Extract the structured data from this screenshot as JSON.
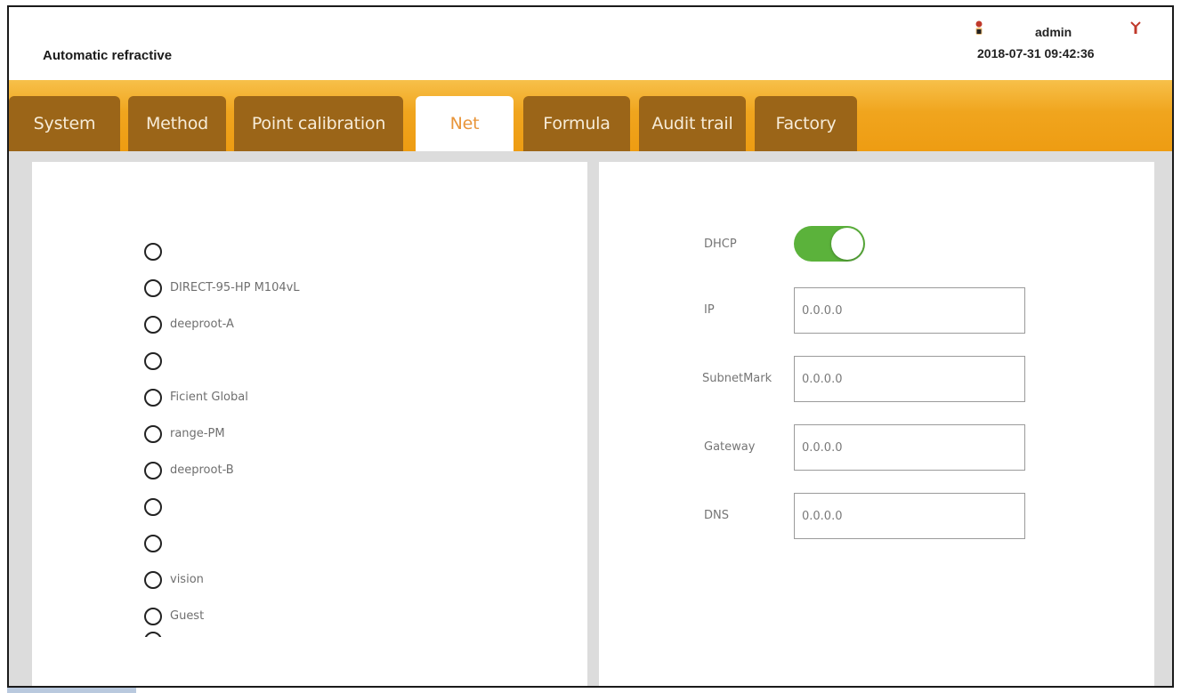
{
  "header": {
    "app_title": "Automatic refractive",
    "user_name": "admin",
    "datetime": "2018-07-31 09:42:36",
    "user_icon": "user-icon",
    "logout_icon": "logout-icon"
  },
  "tabs": [
    {
      "label": "System",
      "active": false
    },
    {
      "label": "Method",
      "active": false
    },
    {
      "label": "Point calibration",
      "active": false
    },
    {
      "label": "Net",
      "active": true
    },
    {
      "label": "Formula",
      "active": false
    },
    {
      "label": "Audit trail",
      "active": false
    },
    {
      "label": "Factory",
      "active": false
    }
  ],
  "wifi_networks": [
    {
      "ssid": ""
    },
    {
      "ssid": "DIRECT-95-HP M104vL"
    },
    {
      "ssid": "deeproot-A"
    },
    {
      "ssid": ""
    },
    {
      "ssid": "Ficient Global"
    },
    {
      "ssid": "range-PM"
    },
    {
      "ssid": "deeproot-B"
    },
    {
      "ssid": ""
    },
    {
      "ssid": ""
    },
    {
      "ssid": "vision"
    },
    {
      "ssid": "Guest"
    }
  ],
  "network_settings": {
    "dhcp_label": "DHCP",
    "dhcp_enabled": true,
    "ip_label": "IP",
    "ip_value": "0.0.0.0",
    "subnet_label": "SubnetMark",
    "subnet_value": "0.0.0.0",
    "gateway_label": "Gateway",
    "gateway_value": "0.0.0.0",
    "dns_label": "DNS",
    "dns_value": "0.0.0.0"
  },
  "colors": {
    "tab_bar": "#f0a51e",
    "tab_inactive": "#9b6518",
    "tab_active_text": "#e8953a",
    "toggle_on": "#5bb23b"
  }
}
